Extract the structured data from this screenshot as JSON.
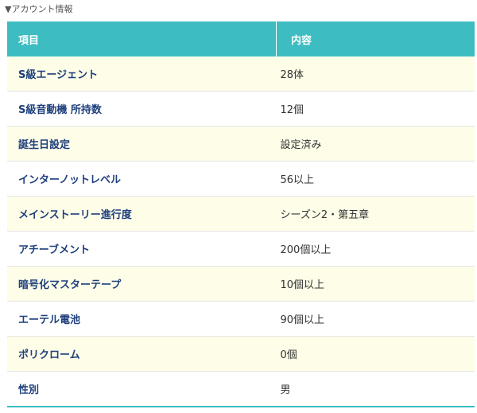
{
  "section_title": "▼アカウント情報",
  "table": {
    "headers": [
      "項目",
      "内容"
    ],
    "rows": [
      {
        "label": "S級エージェント",
        "value": "28体"
      },
      {
        "label": "S級音動機 所持数",
        "value": "12個"
      },
      {
        "label": "誕生日設定",
        "value": "設定済み"
      },
      {
        "label": "インターノットレベル",
        "value": "56以上"
      },
      {
        "label": "メインストーリー進行度",
        "value": "シーズン2・第五章"
      },
      {
        "label": "アチーブメント",
        "value": "200個以上"
      },
      {
        "label": "暗号化マスターテープ",
        "value": "10個以上"
      },
      {
        "label": "エーテル電池",
        "value": "90個以上"
      },
      {
        "label": "ポリクローム",
        "value": "0個"
      },
      {
        "label": "性別",
        "value": "男"
      }
    ]
  },
  "colors": {
    "header_bg": "#3dbdc2",
    "stripe_bg": "#fdfde8",
    "label_text": "#1e3f7c"
  }
}
